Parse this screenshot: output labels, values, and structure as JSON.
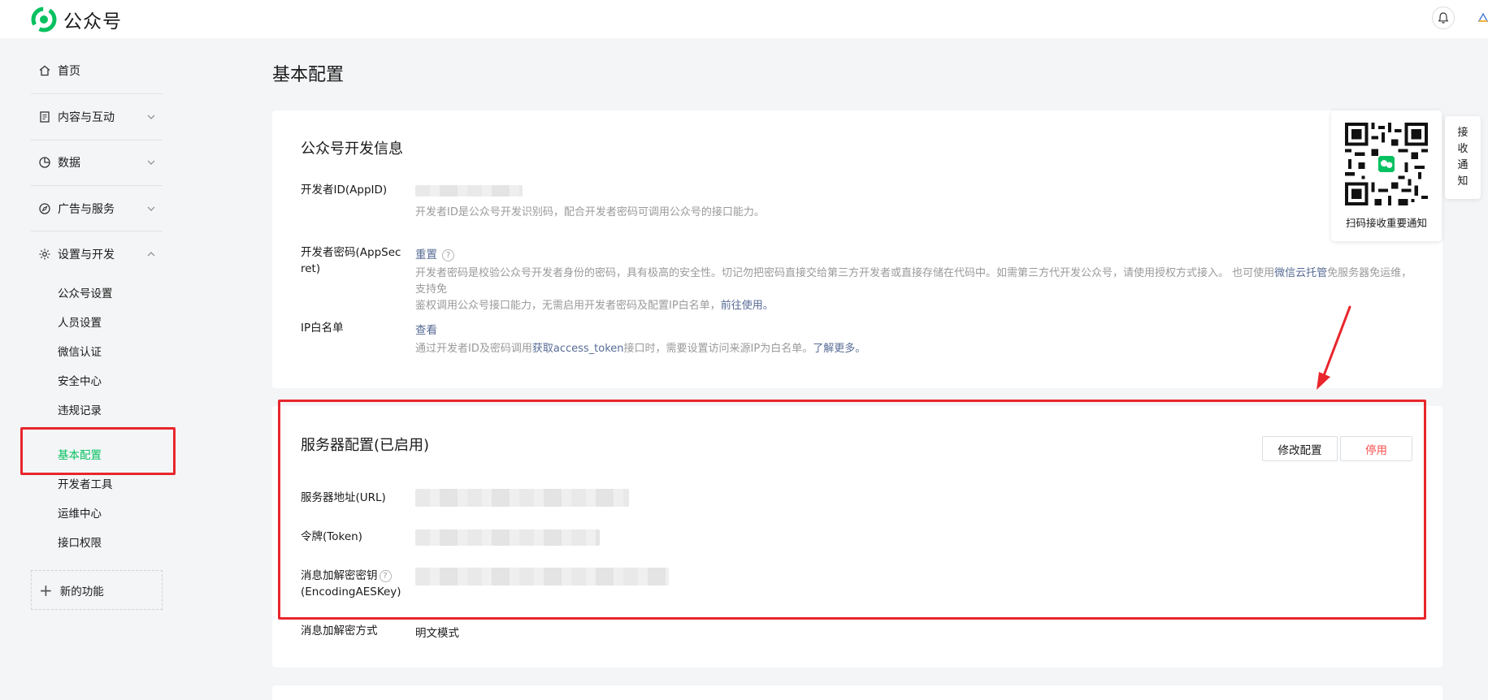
{
  "brand": {
    "name": "公众号",
    "accent": "#07c160"
  },
  "header": {
    "bell_icon": "bell-icon"
  },
  "sidebar": {
    "top_items": [
      {
        "label": "首页",
        "icon": "home-icon"
      },
      {
        "label": "内容与互动",
        "icon": "document-icon"
      },
      {
        "label": "数据",
        "icon": "pie-chart-icon"
      },
      {
        "label": "广告与服务",
        "icon": "compass-icon"
      },
      {
        "label": "设置与开发",
        "icon": "gear-icon"
      }
    ],
    "sub_items": [
      {
        "label": "公众号设置"
      },
      {
        "label": "人员设置"
      },
      {
        "label": "微信认证"
      },
      {
        "label": "安全中心"
      },
      {
        "label": "违规记录"
      },
      {
        "label": "基本配置",
        "active": true
      },
      {
        "label": "开发者工具"
      },
      {
        "label": "运维中心"
      },
      {
        "label": "接口权限"
      }
    ],
    "new_feature": "新的功能"
  },
  "page": {
    "title": "基本配置"
  },
  "dev_info": {
    "title": "公众号开发信息",
    "appid_label": "开发者ID(AppID)",
    "appid_desc": "开发者ID是公众号开发识别码，配合开发者密码可调用公众号的接口能力。",
    "secret_label_1": "开发者密码(AppSec",
    "secret_label_2": "ret)",
    "secret_action": "重置",
    "secret_desc_1a": "开发者密码是校验公众号开发者身份的密码，具有极高的安全性。切记勿把密码直接交给第三方开发者或直接存储在代码中。如需第三方代开发公众号，请使用授权方式接入。 也可使用",
    "secret_desc_1_link": "微信云托管",
    "secret_desc_1b": "免服务器免运维，支持免",
    "secret_desc_2a": "鉴权调用公众号接口能力，无需启用开发者密码及配置IP白名单，",
    "secret_desc_2_link": "前往使用。",
    "ip_label": "IP白名单",
    "ip_action": "查看",
    "ip_desc_a": "通过开发者ID及密码调用",
    "ip_desc_link1": "获取access_token",
    "ip_desc_b": "接口时，需要设置访问来源IP为白名单。",
    "ip_desc_link2": "了解更多。"
  },
  "server_config": {
    "title": "服务器配置(已启用)",
    "modify_button": "修改配置",
    "disable_button": "停用",
    "url_label": "服务器地址(URL)",
    "token_label": "令牌(Token)",
    "aes_label_1": "消息加解密密钥",
    "aes_label_2": "(EncodingAESKey)",
    "mode_label": "消息加解密方式",
    "mode_value": "明文模式"
  },
  "qr_panel": {
    "caption": "扫码接收重要通知"
  },
  "notify_tab": {
    "chars": [
      "接",
      "收",
      "通",
      "知"
    ]
  },
  "colors": {
    "link": "#576b95",
    "danger": "#fa5151",
    "annotation": "#e8262c"
  }
}
